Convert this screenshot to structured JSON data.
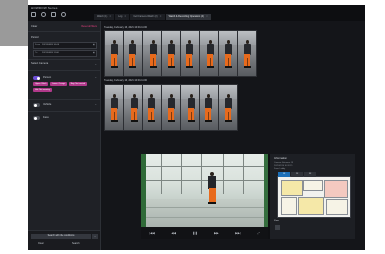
{
  "app": {
    "title": "HOWDOW Series"
  },
  "tabs": [
    {
      "label": "Watch (1)",
      "active": false
    },
    {
      "label": "Log",
      "active": false
    },
    {
      "label": "Cell Camera Watch (2)",
      "active": false
    },
    {
      "label": "Watch & Recording Operation (4)",
      "active": true
    }
  ],
  "sidebar": {
    "heading": "Clear",
    "reset_label": "Reset all filters",
    "period_label": "Period",
    "from_key": "From",
    "from_value": "2021/04/05 10:00",
    "to_key": "To",
    "to_value": "2021/04/05 11:00",
    "camera_section": "Select Camera",
    "person_label": "Person",
    "chips": [
      "Upper: Black",
      "Lower: Orange",
      "Bag: Not carried",
      "Hat: Not wearing"
    ],
    "vehicle_label": "Vehicle",
    "face_label": "Face",
    "search_button": "Search with the conditions",
    "button_a": "Clear",
    "button_b": "Search"
  },
  "results": {
    "group1_title": "Tuesday, February 16, 2021 10:00-11:00",
    "group2_title": "Tuesday, February 16, 2021 10:00-11:00"
  },
  "player": {
    "controls": [
      "|◀◀",
      "◀◀",
      "❚❚",
      "▶▶",
      "▶▶|",
      "⤢"
    ],
    "info_title": "Information",
    "info_lines": [
      "Camera: Entrance 1F",
      "2021/02/16 10:32:15",
      "Zone: Lobby"
    ],
    "map_tabs": [
      "1F",
      "2F",
      "3F"
    ],
    "floor_label": "Floor"
  },
  "colors": {
    "accent": "#6d4fd6",
    "chip": "#b0398a",
    "highlight": "#e2407e"
  }
}
